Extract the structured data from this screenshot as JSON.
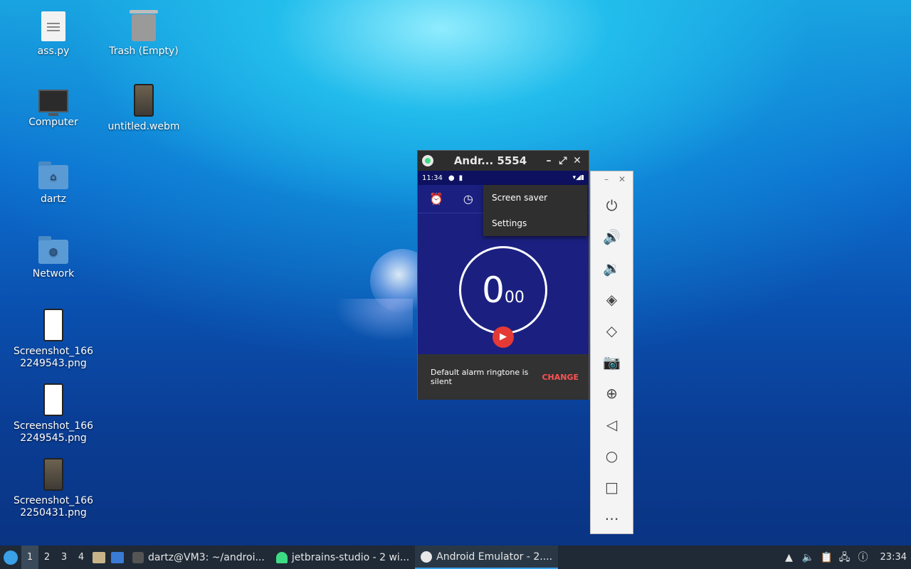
{
  "desktop": {
    "icons": [
      {
        "label": "ass.py",
        "icon": "python-file-icon"
      },
      {
        "label": "Trash (Empty)",
        "icon": "trash-icon"
      },
      {
        "label": "Computer",
        "icon": "computer-icon"
      },
      {
        "label": "untitled.webm",
        "icon": "video-file-icon"
      },
      {
        "label": "dartz",
        "icon": "home-folder-icon"
      },
      {
        "label": "Network",
        "icon": "network-folder-icon"
      },
      {
        "label": "Screenshot_166\n2249543.png",
        "icon": "image-file-icon"
      },
      {
        "label": "Screenshot_166\n2249545.png",
        "icon": "image-file-icon"
      },
      {
        "label": "Screenshot_166\n2250431.png",
        "icon": "image-file-icon"
      }
    ]
  },
  "emulator": {
    "title": "Andr... 5554",
    "status_time": "11:34",
    "menu": [
      "Screen saver",
      "Settings"
    ],
    "timer": {
      "main": "0",
      "sub": "00"
    },
    "snackbar": {
      "message": "Default alarm ringtone is silent",
      "action": "CHANGE"
    },
    "tools": [
      "power-icon",
      "volume-up-icon",
      "volume-down-icon",
      "rotate-left-icon",
      "rotate-right-icon",
      "camera-icon",
      "zoom-icon",
      "back-icon",
      "home-icon",
      "overview-icon",
      "more-icon"
    ]
  },
  "taskbar": {
    "workspaces": [
      "1",
      "2",
      "3",
      "4"
    ],
    "tasks": [
      {
        "label": "dartz@VM3: ~/androi...",
        "icon": "terminal-icon",
        "color": "#555555"
      },
      {
        "label": "jetbrains-studio - 2 wi...",
        "icon": "android-icon",
        "color": "#3ddc84"
      },
      {
        "label": "Android Emulator - 2....",
        "icon": "emulator-icon",
        "color": "#e8e8e8"
      }
    ],
    "clock": "23:34"
  }
}
